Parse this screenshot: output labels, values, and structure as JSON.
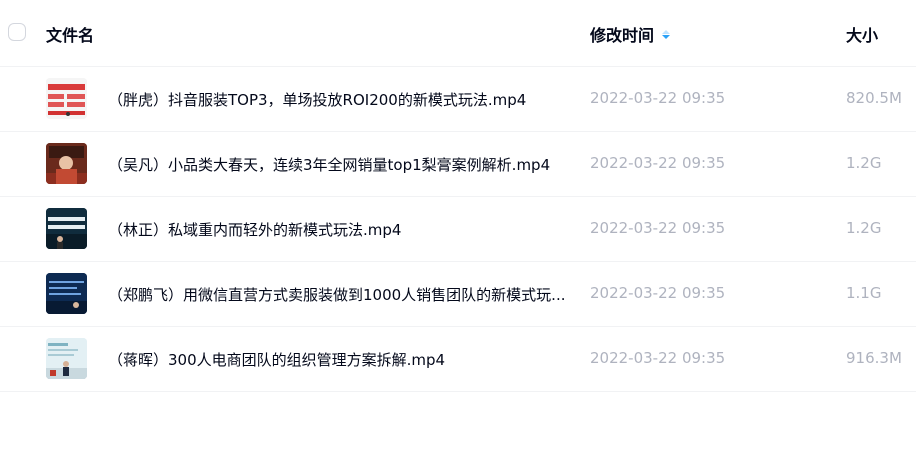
{
  "header": {
    "name_label": "文件名",
    "time_label": "修改时间",
    "size_label": "大小"
  },
  "files": [
    {
      "name": "（胖虎）抖音服装TOP3，单场投放ROI200的新模式玩法.mp4",
      "time": "2022-03-22 09:35",
      "size": "820.5M"
    },
    {
      "name": "（吴凡）小品类大春天，连续3年全网销量top1梨膏案例解析.mp4",
      "time": "2022-03-22 09:35",
      "size": "1.2G"
    },
    {
      "name": "（林正）私域重内而轻外的新模式玩法.mp4",
      "time": "2022-03-22 09:35",
      "size": "1.2G"
    },
    {
      "name": "（郑鹏飞）用微信直营方式卖服装做到1000人销售团队的新模式玩...",
      "time": "2022-03-22 09:35",
      "size": "1.1G"
    },
    {
      "name": "（蒋晖）300人电商团队的组织管理方案拆解.mp4",
      "time": "2022-03-22 09:35",
      "size": "916.3M"
    }
  ],
  "colors": {
    "accent": "#2aa1f7",
    "muted_text": "#afb3bf",
    "text": "#03081a"
  }
}
